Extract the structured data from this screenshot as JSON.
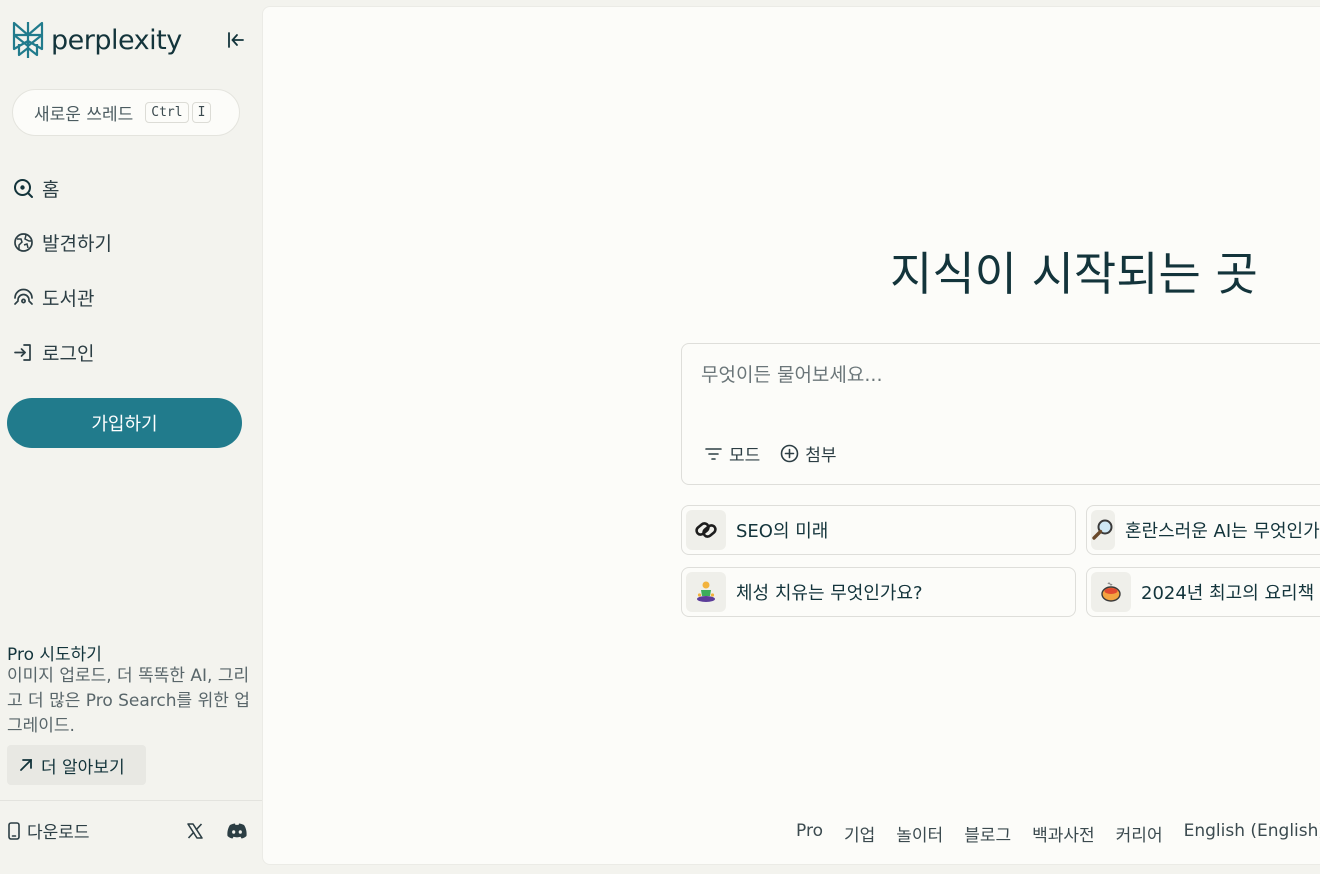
{
  "sidebar": {
    "logo_text": "perplexity",
    "new_thread": {
      "label": "새로운 쓰레드",
      "keys": [
        "Ctrl",
        "I"
      ]
    },
    "nav": [
      {
        "label": "홈",
        "icon": "search-icon"
      },
      {
        "label": "발견하기",
        "icon": "globe-icon"
      },
      {
        "label": "도서관",
        "icon": "library-icon"
      },
      {
        "label": "로그인",
        "icon": "login-icon"
      }
    ],
    "signup_label": "가입하기",
    "pro": {
      "brand": "Pro",
      "title_suffix": " 시도하기",
      "description": "이미지 업로드, 더 똑똑한 AI, 그리고 더 많은 Pro Search를 위한 업그레이드.",
      "learn_more": "더 알아보기"
    },
    "download_label": "다운로드"
  },
  "main": {
    "headline": "지식이 시작되는 곳",
    "ask": {
      "placeholder": "무엇이든 물어보세요...",
      "mode_label": "모드",
      "attach_label": "첨부"
    },
    "suggestions": [
      {
        "label": "SEO의 미래",
        "icon": "link-emoji-icon"
      },
      {
        "label": "혼란스러운 AI는 무엇인가요?",
        "icon": "magnifier-emoji-icon"
      },
      {
        "label": "체성 치유는 무엇인가요?",
        "icon": "meditation-emoji-icon"
      },
      {
        "label": "2024년 최고의 요리책",
        "icon": "food-emoji-icon"
      }
    ],
    "footer": [
      "Pro",
      "기업",
      "놀이터",
      "블로그",
      "백과사전",
      "커리어",
      "English (English)"
    ]
  },
  "colors": {
    "accent": "#217b8c",
    "background": "#f3f3ee",
    "surface": "#fcfcf9",
    "text": "#13343b"
  }
}
